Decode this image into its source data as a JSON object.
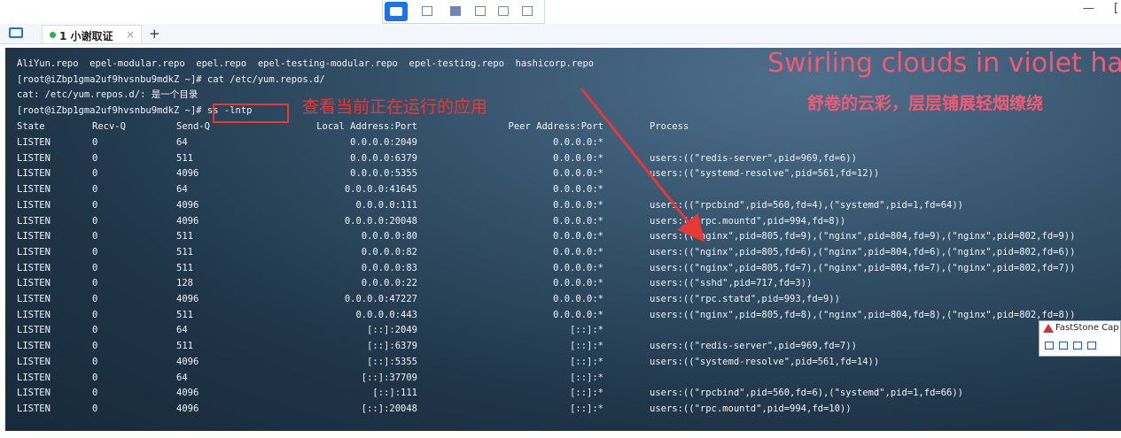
{
  "tab": {
    "label": "1 小谢取证",
    "close": "×",
    "new": "+"
  },
  "window_controls": {
    "minimize": "—",
    "restore": "["
  },
  "terminal": {
    "lines": [
      "AliYun.repo  epel-modular.repo  epel.repo  epel-testing-modular.repo  epel-testing.repo  hashicorp.repo",
      "[root@iZbp1gma2uf9hvsnbu9mdkZ ~]# cat /etc/yum.repos.d/",
      "cat: /etc/yum.repos.d/: 是一个目录",
      "[root@iZbp1gma2uf9hvsnbu9mdkZ ~]# ss -lntp"
    ],
    "headers": [
      "State",
      "Recv-Q",
      "Send-Q",
      "Local Address:Port",
      "Peer Address:Port",
      "Process"
    ],
    "rows": [
      [
        "LISTEN",
        "0",
        "64",
        "0.0.0.0:2049",
        "0.0.0.0:*",
        ""
      ],
      [
        "LISTEN",
        "0",
        "511",
        "0.0.0.0:6379",
        "0.0.0.0:*",
        "users:((\"redis-server\",pid=969,fd=6))"
      ],
      [
        "LISTEN",
        "0",
        "4096",
        "0.0.0.0:5355",
        "0.0.0.0:*",
        "users:((\"systemd-resolve\",pid=561,fd=12))"
      ],
      [
        "LISTEN",
        "0",
        "64",
        "0.0.0.0:41645",
        "0.0.0.0:*",
        ""
      ],
      [
        "LISTEN",
        "0",
        "4096",
        "0.0.0.0:111",
        "0.0.0.0:*",
        "users:((\"rpcbind\",pid=560,fd=4),(\"systemd\",pid=1,fd=64))"
      ],
      [
        "LISTEN",
        "0",
        "4096",
        "0.0.0.0:20048",
        "0.0.0.0:*",
        "users:((\"rpc.mountd\",pid=994,fd=8))"
      ],
      [
        "LISTEN",
        "0",
        "511",
        "0.0.0.0:80",
        "0.0.0.0:*",
        "users:((\"nginx\",pid=805,fd=9),(\"nginx\",pid=804,fd=9),(\"nginx\",pid=802,fd=9))"
      ],
      [
        "LISTEN",
        "0",
        "511",
        "0.0.0.0:82",
        "0.0.0.0:*",
        "users:((\"nginx\",pid=805,fd=6),(\"nginx\",pid=804,fd=6),(\"nginx\",pid=802,fd=6))"
      ],
      [
        "LISTEN",
        "0",
        "511",
        "0.0.0.0:83",
        "0.0.0.0:*",
        "users:((\"nginx\",pid=805,fd=7),(\"nginx\",pid=804,fd=7),(\"nginx\",pid=802,fd=7))"
      ],
      [
        "LISTEN",
        "0",
        "128",
        "0.0.0.0:22",
        "0.0.0.0:*",
        "users:((\"sshd\",pid=717,fd=3))"
      ],
      [
        "LISTEN",
        "0",
        "4096",
        "0.0.0.0:47227",
        "0.0.0.0:*",
        "users:((\"rpc.statd\",pid=993,fd=9))"
      ],
      [
        "LISTEN",
        "0",
        "511",
        "0.0.0.0:443",
        "0.0.0.0:*",
        "users:((\"nginx\",pid=805,fd=8),(\"nginx\",pid=804,fd=8),(\"nginx\",pid=802,fd=8))"
      ],
      [
        "LISTEN",
        "0",
        "64",
        "[::]:2049",
        "[::]:*",
        ""
      ],
      [
        "LISTEN",
        "0",
        "511",
        "[::]:6379",
        "[::]:*",
        "users:((\"redis-server\",pid=969,fd=7))"
      ],
      [
        "LISTEN",
        "0",
        "4096",
        "[::]:5355",
        "[::]:*",
        "users:((\"systemd-resolve\",pid=561,fd=14))"
      ],
      [
        "LISTEN",
        "0",
        "64",
        "[::]:37709",
        "[::]:*",
        ""
      ],
      [
        "LISTEN",
        "0",
        "4096",
        "[::]:111",
        "[::]:*",
        "users:((\"rpcbind\",pid=560,fd=6),(\"systemd\",pid=1,fd=66))"
      ],
      [
        "LISTEN",
        "0",
        "4096",
        "[::]:20048",
        "[::]:*",
        "users:((\"rpc.mountd\",pid=994,fd=10))"
      ]
    ]
  },
  "annotation": {
    "text": "查看当前正在运行的应用",
    "color": "#e53935"
  },
  "wallpaper": {
    "line1": "Swirling clouds in violet ha",
    "line2": "舒卷的云彩，层层铺展轻烟缭绕"
  },
  "faststone": {
    "title": "FastStone Cap"
  },
  "icons": [
    "camera-icon",
    "folder-icon",
    "fullscreen-icon",
    "record-icon",
    "faststone-logo-icon"
  ]
}
